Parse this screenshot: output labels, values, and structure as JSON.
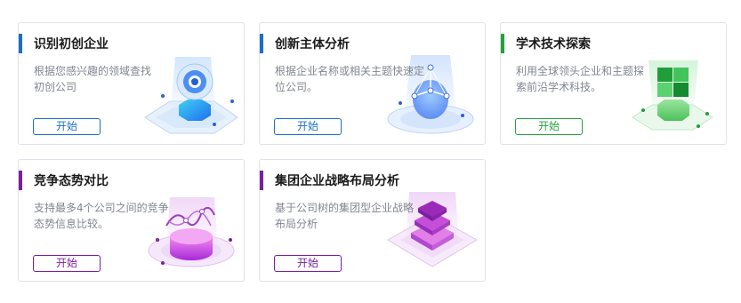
{
  "cards": [
    {
      "title": "识别初创企业",
      "desc": "根据您感兴趣的领域查找初创公司",
      "button": "开始",
      "accent": "#1a6fc9",
      "icon": "radar-disc-icon"
    },
    {
      "title": "创新主体分析",
      "desc": "根据企业名称或相关主题快速定位公司。",
      "button": "开始",
      "accent": "#1a6fc9",
      "icon": "network-node-icon"
    },
    {
      "title": "学术技术探索",
      "desc": "利用全球领头企业和主题探索前沿学术科技。",
      "button": "开始",
      "accent": "#21a33a",
      "icon": "green-cube-icon"
    },
    {
      "title": "竞争态势对比",
      "desc": "支持最多4个公司之间的竞争态势信息比较。",
      "button": "开始",
      "accent": "#7a1fa2",
      "icon": "wave-chart-icon"
    },
    {
      "title": "集团企业战略布局分析",
      "desc": "基于公司树的集团型企业战略布局分析",
      "button": "开始",
      "accent": "#7a1fa2",
      "icon": "layer-stack-icon"
    }
  ]
}
